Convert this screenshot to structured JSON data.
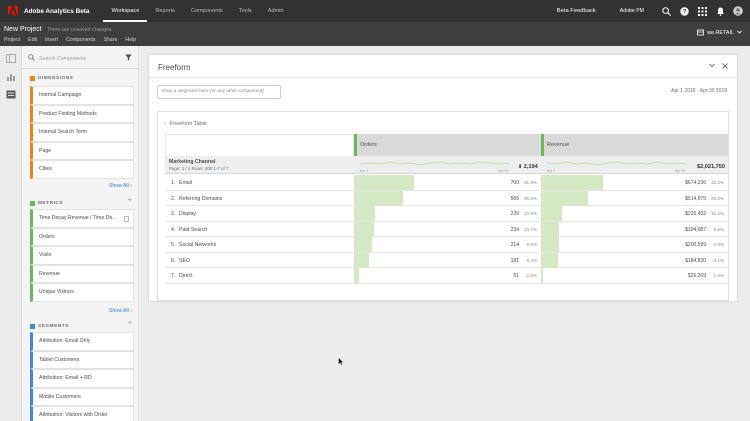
{
  "app": {
    "title": "Adobe Analytics Beta"
  },
  "topnav": [
    "Workspace",
    "Reports",
    "Components",
    "Tools",
    "Admin"
  ],
  "topbar": {
    "beta_feedback": "Beta Feedback",
    "org": "Adobe PM"
  },
  "project": {
    "name": "New Project",
    "status": "There are unsaved changes",
    "menu": [
      "Project",
      "Edit",
      "Insert",
      "Components",
      "Share",
      "Help"
    ],
    "report_suite": "we.RETAIL"
  },
  "panel": {
    "search_placeholder": "Search Components",
    "dimensions": {
      "title": "DIMENSIONS",
      "items": [
        "Internal Campaign",
        "Product Finding Methods",
        "Internal Search Term",
        "Page",
        "Cities"
      ],
      "show_all": "Show All"
    },
    "metrics": {
      "title": "METRICS",
      "items": [
        "Time Decay Revenue / Time De...",
        "Orders",
        "Visits",
        "Revenue",
        "Unique Visitors"
      ],
      "show_all": "Show All"
    },
    "segments": {
      "title": "SEGMENTS",
      "items": [
        "Attribution: Email Only",
        "Tablet Customers",
        "Attribution: Email + RD",
        "Mobile Customers",
        "Attribution: Visitors with Order"
      ]
    }
  },
  "freeform": {
    "title": "Freeform",
    "dropzone": "Drop a Segment Here (or any other component)",
    "date_range": "Apr 1 2018 - Apr 30 2018",
    "table_title": "Freeform Table",
    "dimension": "Marketing Channel",
    "page_label": "Page: 1 / 1",
    "rows_label": "Rows:",
    "rows_value": "400",
    "rows_extra": "1-7 of 7",
    "spark_start": "Apr 1",
    "spark_end": "Apr 30",
    "columns": [
      {
        "name": "Orders",
        "total": "2,194"
      },
      {
        "name": "Revenue",
        "total": "$2,021,750"
      }
    ],
    "rows": [
      {
        "n": "1.",
        "label": "Email",
        "orders": "700",
        "orders_pct": "31.9%",
        "orders_share": 0.319,
        "revenue": "$674,236",
        "revenue_pct": "33.3%",
        "revenue_share": 0.333
      },
      {
        "n": "2.",
        "label": "Referring Domains",
        "orders": "565",
        "orders_pct": "25.8%",
        "orders_share": 0.258,
        "revenue": "$514,675",
        "revenue_pct": "25.5%",
        "revenue_share": 0.255
      },
      {
        "n": "3.",
        "label": "Display",
        "orders": "239",
        "orders_pct": "10.9%",
        "orders_share": 0.109,
        "revenue": "$226,452",
        "revenue_pct": "11.2%",
        "revenue_share": 0.112
      },
      {
        "n": "4.",
        "label": "Paid Search",
        "orders": "234",
        "orders_pct": "10.7%",
        "orders_share": 0.107,
        "revenue": "$194,687",
        "revenue_pct": "9.6%",
        "revenue_share": 0.096
      },
      {
        "n": "5.",
        "label": "Social Networks",
        "orders": "214",
        "orders_pct": "9.8%",
        "orders_share": 0.098,
        "revenue": "$200,599",
        "revenue_pct": "9.9%",
        "revenue_share": 0.099
      },
      {
        "n": "6.",
        "label": "SEO",
        "orders": "181",
        "orders_pct": "8.2%",
        "orders_share": 0.082,
        "revenue": "$184,830",
        "revenue_pct": "9.1%",
        "revenue_share": 0.091
      },
      {
        "n": "7.",
        "label": "Direct",
        "orders": "61",
        "orders_pct": "2.8%",
        "orders_share": 0.028,
        "revenue": "$26,269",
        "revenue_pct": "1.3%",
        "revenue_share": 0.013
      }
    ]
  },
  "colors": {
    "dimension": "#e68619",
    "metric": "#6cb65c",
    "segment": "#3b8ad7",
    "bar_fill": "#d3e8c3",
    "link": "#2d7bd6"
  }
}
